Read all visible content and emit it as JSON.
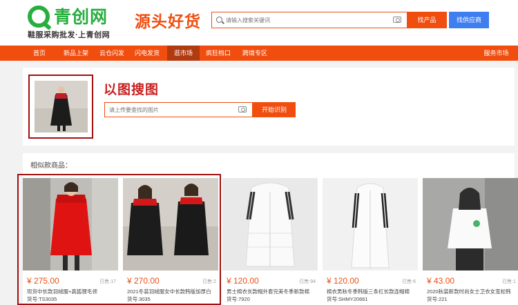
{
  "header": {
    "logo_text": "青创网",
    "logo_sub": "鞋服采购批发·上青创网",
    "slogan": "源头好货",
    "search_placeholder": "请输入搜索关键词",
    "btn_product": "找产品",
    "btn_supplier": "找供应商"
  },
  "nav": {
    "items": [
      "首页",
      "新品上架",
      "云仓闪发",
      "闪电发货",
      "逛市场",
      "疯狂档口",
      "跨境专区"
    ],
    "right": "服务市场",
    "active_index": 4
  },
  "image_search": {
    "title": "以图搜图",
    "placeholder": "请上传要查找的图片",
    "button": "开始识别"
  },
  "similar": {
    "label": "相似款商品：",
    "products": [
      {
        "price": "¥ 275.00",
        "sold": "已售:17",
        "desc": "现货中长款羽绒服+真狐狸毛领",
        "no": "货号:TS3035"
      },
      {
        "price": "¥ 270.00",
        "sold": "已售:2",
        "desc": "2021冬装羽绒服女中长款韩版加厚白",
        "no": "货号:3035"
      },
      {
        "price": "¥ 120.00",
        "sold": "已售:94",
        "desc": "男士棉衣长款帽外套完美冬季新款棉",
        "no": "货号:7920"
      },
      {
        "price": "¥ 120.00",
        "sold": "已售:6",
        "desc": "棉衣男秋冬季韩版三条杠长款连帽棉",
        "no": "货号:SHMY20661"
      },
      {
        "price": "¥ 43.00",
        "sold": "已售:1",
        "desc": "2020秋装新款时尚女士卫衣女宽松韩",
        "no": "货号:221"
      }
    ]
  }
}
